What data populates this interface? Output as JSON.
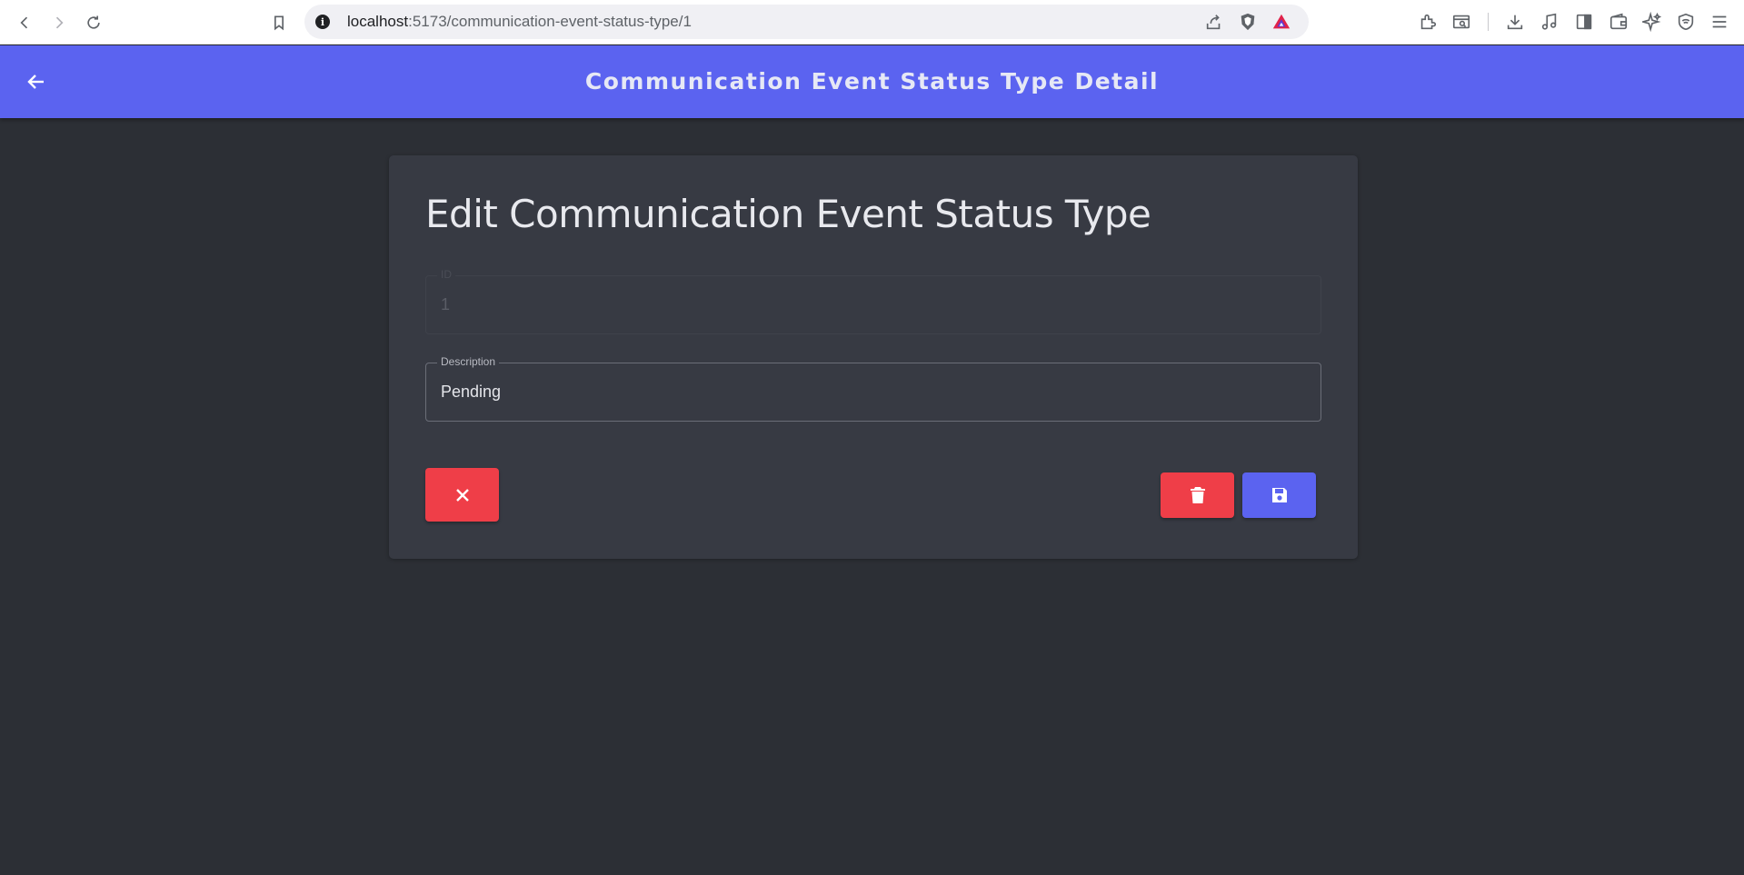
{
  "browser": {
    "url_host": "localhost",
    "url_path": ":5173/communication-event-status-type/1",
    "icons": [
      "back-icon",
      "forward-icon",
      "reload-icon",
      "bookmark-icon",
      "info-icon",
      "share-icon",
      "brave-shield-icon",
      "brave-rewards-icon",
      "extensions-icon",
      "screenshot-icon",
      "download-icon",
      "media-icon",
      "sidebar-icon",
      "wallet-icon",
      "leo-ai-icon",
      "vpn-icon",
      "menu-icon"
    ]
  },
  "header": {
    "title": "Communication Event Status Type Detail"
  },
  "form": {
    "title": "Edit Communication Event Status Type",
    "id_label": "ID",
    "id_value": "1",
    "description_label": "Description",
    "description_value": "Pending"
  },
  "colors": {
    "accent": "#5b63f0",
    "danger": "#ef3e48",
    "background": "#2c2f35",
    "card": "#373a43"
  }
}
